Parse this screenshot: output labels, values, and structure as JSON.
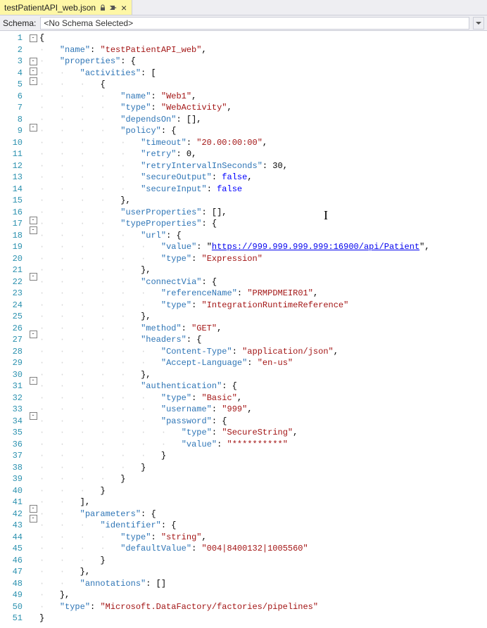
{
  "tab": {
    "title": "testPatientAPI_web.json"
  },
  "schema": {
    "label": "Schema:",
    "value": "<No Schema Selected>"
  },
  "code": {
    "l1": "{",
    "l2": {
      "key": "\"name\"",
      "val": "\"testPatientAPI_web\"",
      "after": ","
    },
    "l3": {
      "key": "\"properties\"",
      "after": ": {"
    },
    "l4": {
      "key": "\"activities\"",
      "after": ": ["
    },
    "l5": "{",
    "l6": {
      "key": "\"name\"",
      "val": "\"Web1\"",
      "after": ","
    },
    "l7": {
      "key": "\"type\"",
      "val": "\"WebActivity\"",
      "after": ","
    },
    "l8": {
      "key": "\"dependsOn\"",
      "after": ": [],"
    },
    "l9": {
      "key": "\"policy\"",
      "after": ": {"
    },
    "l10": {
      "key": "\"timeout\"",
      "val": "\"20.00:00:00\"",
      "after": ","
    },
    "l11": {
      "key": "\"retry\"",
      "val": "0",
      "after": ","
    },
    "l12": {
      "key": "\"retryIntervalInSeconds\"",
      "val": "30",
      "after": ","
    },
    "l13": {
      "key": "\"secureOutput\"",
      "val": "false",
      "after": ","
    },
    "l14": {
      "key": "\"secureInput\"",
      "val": "false"
    },
    "l15": "},",
    "l16": {
      "key": "\"userProperties\"",
      "after": ": [],"
    },
    "l17": {
      "key": "\"typeProperties\"",
      "after": ": {"
    },
    "l18": {
      "key": "\"url\"",
      "after": ": {"
    },
    "l19": {
      "key": "\"value\"",
      "pre": ": \"",
      "url": "https://999.999.999.999:16900/api/Patient",
      "post": "\","
    },
    "l20": {
      "key": "\"type\"",
      "val": "\"Expression\""
    },
    "l21": "},",
    "l22": {
      "key": "\"connectVia\"",
      "after": ": {"
    },
    "l23": {
      "key": "\"referenceName\"",
      "val": "\"PRMPDMEIR01\"",
      "after": ","
    },
    "l24": {
      "key": "\"type\"",
      "val": "\"IntegrationRuntimeReference\""
    },
    "l25": "},",
    "l26": {
      "key": "\"method\"",
      "val": "\"GET\"",
      "after": ","
    },
    "l27": {
      "key": "\"headers\"",
      "after": ": {"
    },
    "l28": {
      "key": "\"Content-Type\"",
      "val": "\"application/json\"",
      "after": ","
    },
    "l29": {
      "key": "\"Accept-Language\"",
      "val": "\"en-us\""
    },
    "l30": "},",
    "l31": {
      "key": "\"authentication\"",
      "after": ": {"
    },
    "l32": {
      "key": "\"type\"",
      "val": "\"Basic\"",
      "after": ","
    },
    "l33": {
      "key": "\"username\"",
      "val": "\"999\"",
      "after": ","
    },
    "l34": {
      "key": "\"password\"",
      "after": ": {"
    },
    "l35": {
      "key": "\"type\"",
      "val": "\"SecureString\"",
      "after": ","
    },
    "l36": {
      "key": "\"value\"",
      "val": "\"**********\""
    },
    "l37": "}",
    "l38": "}",
    "l39": "}",
    "l40": "}",
    "l41": "],",
    "l42": {
      "key": "\"parameters\"",
      "after": ": {"
    },
    "l43": {
      "key": "\"identifier\"",
      "after": ": {"
    },
    "l44": {
      "key": "\"type\"",
      "val": "\"string\"",
      "after": ","
    },
    "l45": {
      "key": "\"defaultValue\"",
      "val": "\"004|8400132|1005560\""
    },
    "l46": "}",
    "l47": "},",
    "l48": {
      "key": "\"annotations\"",
      "after": ": []"
    },
    "l49": "},",
    "l50": {
      "key": "\"type\"",
      "val": "\"Microsoft.DataFactory/factories/pipelines\""
    },
    "l51": "}"
  },
  "indents": {
    "l1": 0,
    "l2": 1,
    "l3": 1,
    "l4": 2,
    "l5": 3,
    "l6": 4,
    "l7": 4,
    "l8": 4,
    "l9": 4,
    "l10": 5,
    "l11": 5,
    "l12": 5,
    "l13": 5,
    "l14": 5,
    "l15": 4,
    "l16": 4,
    "l17": 4,
    "l18": 5,
    "l19": 6,
    "l20": 6,
    "l21": 5,
    "l22": 5,
    "l23": 6,
    "l24": 6,
    "l25": 5,
    "l26": 5,
    "l27": 5,
    "l28": 6,
    "l29": 6,
    "l30": 5,
    "l31": 5,
    "l32": 6,
    "l33": 6,
    "l34": 6,
    "l35": 7,
    "l36": 7,
    "l37": 6,
    "l38": 5,
    "l39": 4,
    "l40": 3,
    "l41": 2,
    "l42": 2,
    "l43": 3,
    "l44": 4,
    "l45": 4,
    "l46": 3,
    "l47": 2,
    "l48": 2,
    "l49": 1,
    "l50": 1,
    "l51": 0
  },
  "lines": 51,
  "folds": [
    1,
    3,
    4,
    5,
    9,
    17,
    18,
    22,
    27,
    31,
    34,
    42,
    43
  ]
}
